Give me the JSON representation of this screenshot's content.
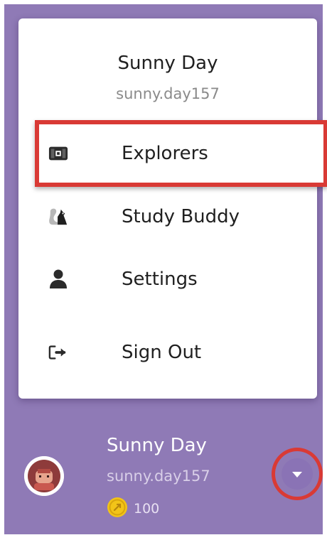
{
  "menu": {
    "header": {
      "name": "Sunny Day",
      "username": "sunny.day157"
    },
    "items": [
      {
        "label": "Explorers",
        "icon": "treasure-chest-icon",
        "highlighted": true
      },
      {
        "label": "Study Buddy",
        "icon": "squirrel-icon"
      },
      {
        "label": "Settings",
        "icon": "person-icon"
      },
      {
        "label": "Sign Out",
        "icon": "sign-out-icon"
      }
    ]
  },
  "profile": {
    "name": "Sunny Day",
    "username": "sunny.day157",
    "coins": "100",
    "avatar_icon": "character-avatar-icon",
    "coin_icon": "coin-icon"
  },
  "colors": {
    "panel_background": "#8f7ab6",
    "highlight": "#d93a35",
    "menu_background": "#ffffff"
  }
}
